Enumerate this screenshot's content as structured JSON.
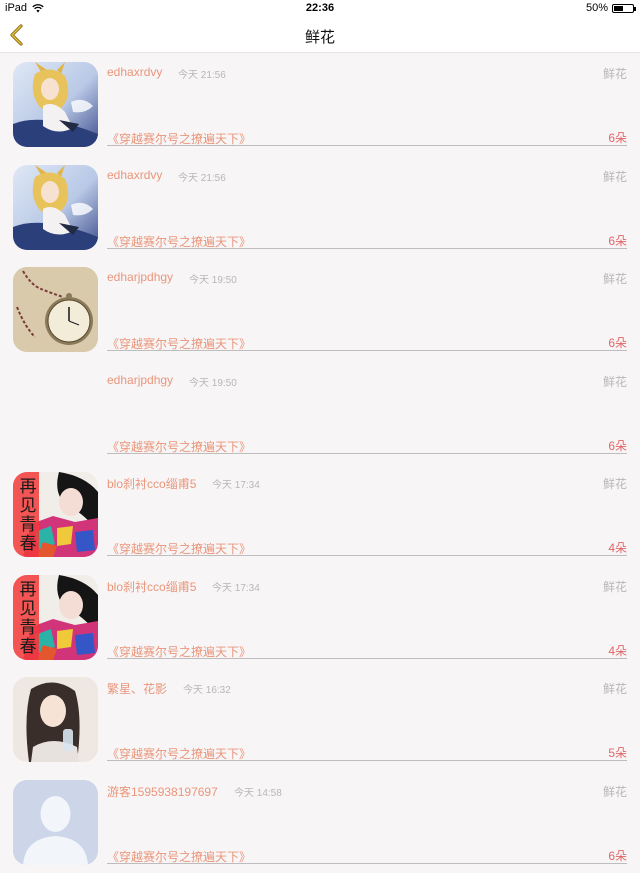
{
  "status_bar": {
    "device": "iPad",
    "time": "22:36",
    "battery": "50%",
    "battery_level": 0.5
  },
  "nav": {
    "title": "鲜花"
  },
  "rows": [
    {
      "username": "edhaxrdvy",
      "time": "今天 21:56",
      "gift": "鲜花",
      "book": "《穿越赛尔号之撩遍天下》",
      "count": "6朵",
      "avatar": "anime-girl"
    },
    {
      "username": "edhaxrdvy",
      "time": "今天 21:56",
      "gift": "鲜花",
      "book": "《穿越赛尔号之撩遍天下》",
      "count": "6朵",
      "avatar": "anime-girl"
    },
    {
      "username": "edharjpdhgy",
      "time": "今天 19:50",
      "gift": "鲜花",
      "book": "《穿越赛尔号之撩遍天下》",
      "count": "6朵",
      "avatar": "pocket-watch"
    },
    {
      "username": "edharjpdhgy",
      "time": "今天 19:50",
      "gift": "鲜花",
      "book": "《穿越赛尔号之撩遍天下》",
      "count": "6朵",
      "avatar": "none"
    },
    {
      "username": "blo刹衬cco缁甫5",
      "time": "今天 17:34",
      "gift": "鲜花",
      "book": "《穿越赛尔号之撩遍天下》",
      "count": "4朵",
      "avatar": "farewell-youth",
      "avatar_text": "再见青春"
    },
    {
      "username": "blo刹衬cco缁甫5",
      "time": "今天 17:34",
      "gift": "鲜花",
      "book": "《穿越赛尔号之撩遍天下》",
      "count": "4朵",
      "avatar": "farewell-youth",
      "avatar_text": "再见青春"
    },
    {
      "username": "繁星、花影",
      "time": "今天 16:32",
      "gift": "鲜花",
      "book": "《穿越赛尔号之撩遍天下》",
      "count": "5朵",
      "avatar": "girl-photo"
    },
    {
      "username": "游客1595938197697",
      "time": "今天 14:58",
      "gift": "鲜花",
      "book": "《穿越赛尔号之撩遍天下》",
      "count": "6朵",
      "avatar": "default-person"
    }
  ]
}
